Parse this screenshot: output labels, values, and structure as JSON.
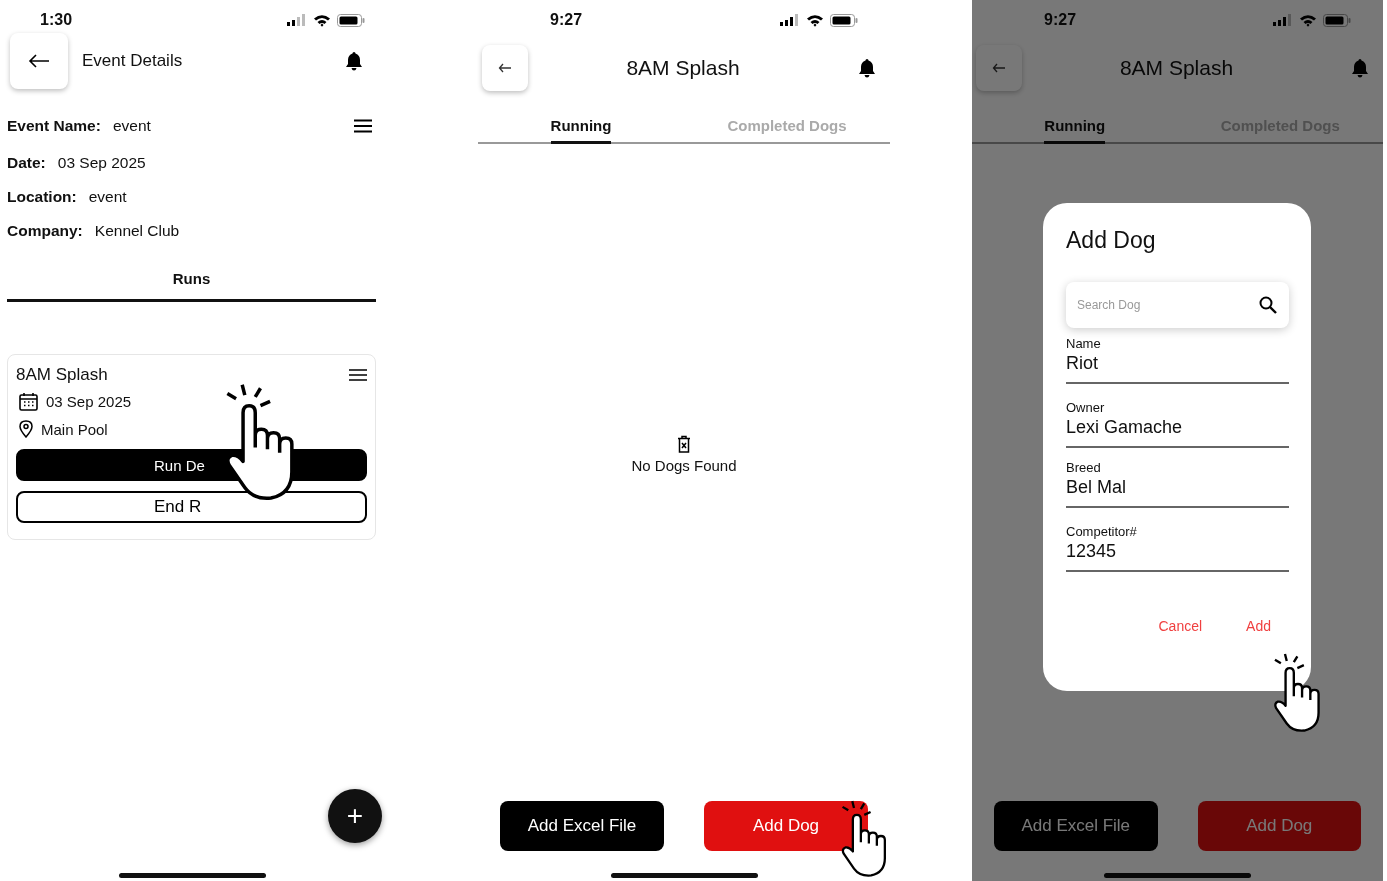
{
  "screens": [
    {
      "kind": "event_details",
      "time": "1:30",
      "title": "Event Details",
      "fields": [
        {
          "label": "Event Name:",
          "value": "event"
        },
        {
          "label": "Date:",
          "value": "03 Sep 2025"
        },
        {
          "label": "Location:",
          "value": "event"
        },
        {
          "label": "Company:",
          "value": "Kennel Club"
        }
      ],
      "tabs": [
        {
          "label": "Runs",
          "selected": true
        }
      ],
      "run_card": {
        "title": "8AM Splash",
        "date": "03 Sep 2025",
        "location": "Main Pool",
        "buttons": [
          {
            "label": "Run De",
            "kind": "filled"
          },
          {
            "label": "End R",
            "kind": "outline"
          }
        ]
      },
      "fab": {
        "label": "+"
      }
    },
    {
      "kind": "run",
      "time": "9:27",
      "title": "8AM Splash",
      "tabs": [
        {
          "label": "Running",
          "selected": true
        },
        {
          "label": "Completed Dogs",
          "selected": false
        }
      ],
      "empty_message": "No Dogs Found",
      "buttons": [
        {
          "label": "Add Excel File",
          "kind": "dark"
        },
        {
          "label": "Add Dog",
          "kind": "red"
        }
      ]
    },
    {
      "kind": "run",
      "time": "9:27",
      "title": "8AM Splash",
      "tabs": [
        {
          "label": "Running",
          "selected": true
        },
        {
          "label": "Completed Dogs",
          "selected": false
        }
      ],
      "buttons": [
        {
          "label": "Add Excel File",
          "kind": "dark"
        },
        {
          "label": "Add Dog",
          "kind": "red"
        }
      ],
      "dialog": {
        "title": "Add Dog",
        "search": {
          "placeholder": "Search Dog"
        },
        "fields": [
          {
            "label": "Name",
            "value": "Riot"
          },
          {
            "label": "Owner",
            "value": "Lexi Gamache"
          },
          {
            "label": "Breed",
            "value": "Bel Mal"
          },
          {
            "label": "Competitor#",
            "value": "12345"
          }
        ],
        "actions": [
          "Cancel",
          "Add"
        ]
      }
    }
  ]
}
